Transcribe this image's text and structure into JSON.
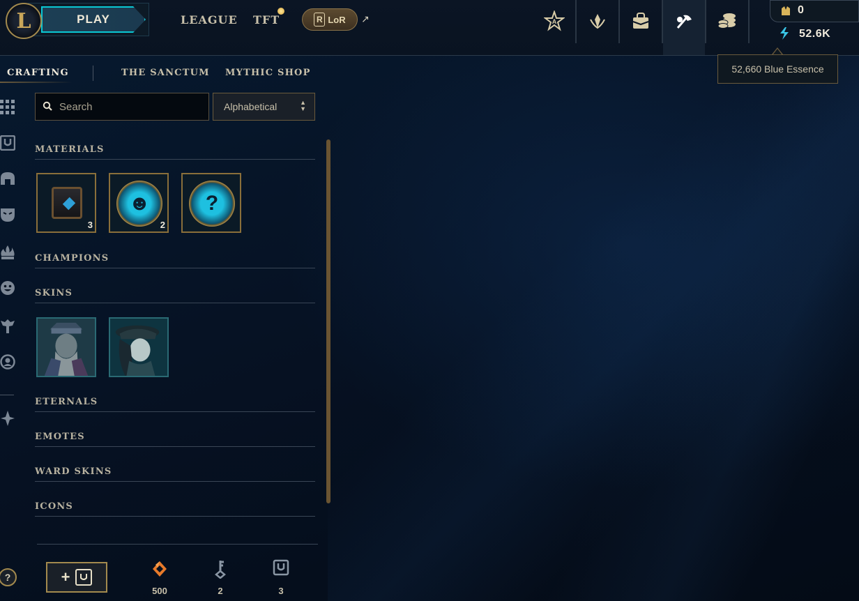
{
  "header": {
    "logo_letter": "L",
    "play_label": "PLAY",
    "nav_links": [
      "LEAGUE",
      "TFT"
    ],
    "lor_label": "LoR",
    "lor_letter": "R",
    "external_glyph": "↗",
    "icons": [
      "tft-pass-icon",
      "ranked-icon",
      "store-icon",
      "loot-crafting-icon",
      "currency-icon"
    ],
    "active_icon": "loot-crafting-icon"
  },
  "currency": {
    "rp_value": "0",
    "be_value": "52.6K",
    "be_tooltip": "52,660 Blue Essence",
    "rp_color": "#d8b45a",
    "be_color": "#3ac6e6"
  },
  "subtabs": {
    "crafting": "CRAFTING",
    "sanctum": "THE SANCTUM",
    "mythic_shop": "MYTHIC SHOP",
    "active": "CRAFTING"
  },
  "filters": {
    "search_placeholder": "Search",
    "search_value": "",
    "sort_value": "Alphabetical"
  },
  "sections": {
    "materials": "MATERIALS",
    "champions": "CHAMPIONS",
    "skins": "SKINS",
    "eternals": "ETERNALS",
    "emotes": "EMOTES",
    "ward_skins": "WARD SKINS",
    "icons": "ICONS"
  },
  "materials_items": [
    {
      "icon": "hextech-chest-icon",
      "count": "3"
    },
    {
      "icon": "emote-orb-icon",
      "glyph": "☻",
      "count": "2"
    },
    {
      "icon": "mystery-orb-icon",
      "glyph": "?",
      "count": ""
    }
  ],
  "skins_items": [
    {
      "icon": "skin-shard-1"
    },
    {
      "icon": "skin-shard-2"
    }
  ],
  "footer": {
    "add_label": "+",
    "orange_essence": "500",
    "keys": "2",
    "chests": "3",
    "orange_color": "#e87a2a"
  },
  "help_glyph": "?"
}
